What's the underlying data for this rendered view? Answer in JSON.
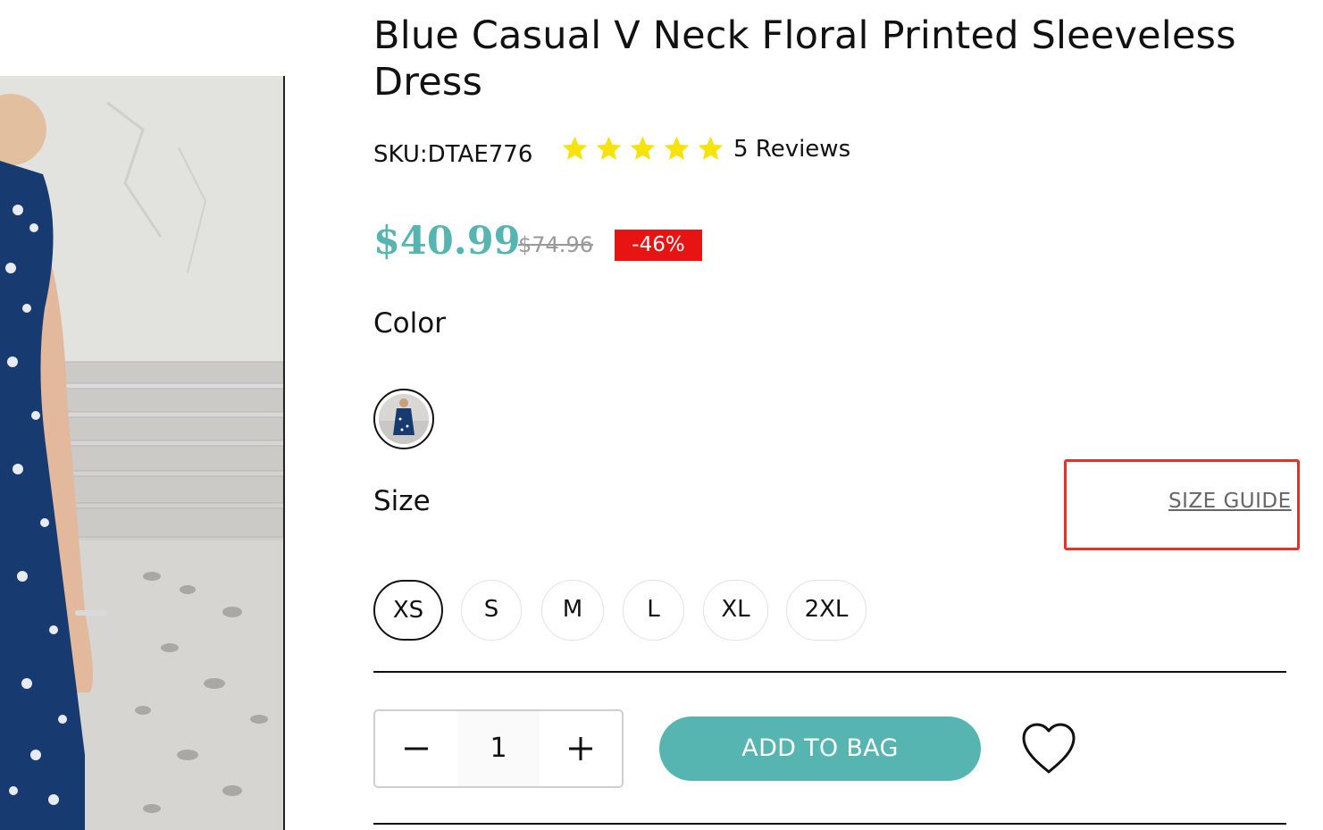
{
  "product": {
    "title": "Blue Casual V Neck Floral Printed Sleeveless Dress",
    "sku": "SKU:DTAE776",
    "rating": 5,
    "rating_max": 5,
    "reviews_label": "5 Reviews",
    "price": "$40.99",
    "original_price": "$74.96",
    "discount": "-46%"
  },
  "colors": {
    "label": "Color",
    "options": [
      {
        "name": "Blue",
        "selected": true
      }
    ]
  },
  "sizes": {
    "label": "Size",
    "guide_label": "SIZE GUIDE",
    "options": [
      {
        "label": "XS",
        "selected": true
      },
      {
        "label": "S",
        "selected": false
      },
      {
        "label": "M",
        "selected": false
      },
      {
        "label": "L",
        "selected": false
      },
      {
        "label": "XL",
        "selected": false
      },
      {
        "label": "2XL",
        "selected": false
      }
    ]
  },
  "purchase": {
    "quantity": "1",
    "add_to_bag_label": "ADD TO BAG"
  },
  "theme": {
    "accent": "#56b5b1",
    "discount_red": "#e81414",
    "star_yellow": "#f5e30a",
    "highlight_red": "#e8302a"
  }
}
